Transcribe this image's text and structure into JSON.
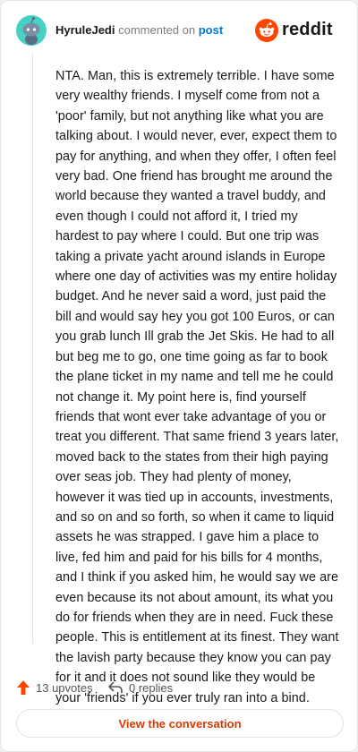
{
  "comment": {
    "username": "HyruleJedi",
    "action_text": "commented on",
    "post_link": "post",
    "body": "NTA. Man, this is extremely terrible. I have some very wealthy friends. I myself come from not a 'poor' family, but not anything like what you are talking about. I would never, ever, expect them to pay for anything, and when they offer, I often feel very bad. One friend has brought me around the world because they wanted a travel buddy, and even though I could not afford it, I tried my hardest to pay where I could. But one trip was taking a private yacht around islands in Europe where one day of activities was my entire holiday budget. And he never said a word, just paid the bill and would say hey you got 100 Euros, or can you grab lunch Ill grab the Jet Skis. He had to all but beg me to go, one time going as far to book the plane ticket in my name and tell me he could not change it. My point here is, find yourself friends that wont ever take advantage of you or treat you different. That same friend 3 years later, moved back to the states from their high paying over seas job. They had plenty of money, however it was tied up in accounts, investments, and so on and so forth, so when it came to liquid assets he was strapped. I gave him a place to live, fed him and paid for his bills for 4 months, and I think if you asked him, he would say we are even because its not about amount, its what you do for friends when they are in need. Fuck these people. This is entitlement at its finest. They want the lavish party because they know you can pay for it and it does not sound like they would be your 'friends' if you ever truly ran into a bind."
  },
  "brand": {
    "wordmark": "reddit",
    "color": "#ff4500"
  },
  "footer": {
    "upvotes": "13 upvotes",
    "replies": "0 replies",
    "cta": "View the conversation"
  },
  "icons": {
    "avatar": "snoo-avatar-icon",
    "logo": "reddit-logo-icon",
    "upvote": "upvote-arrow-icon",
    "reply": "reply-icon"
  },
  "colors": {
    "link": "#0079d3",
    "upvote": "#ff4500",
    "cta_text": "#d93a00",
    "avatar_bg": "#46d1c5"
  }
}
